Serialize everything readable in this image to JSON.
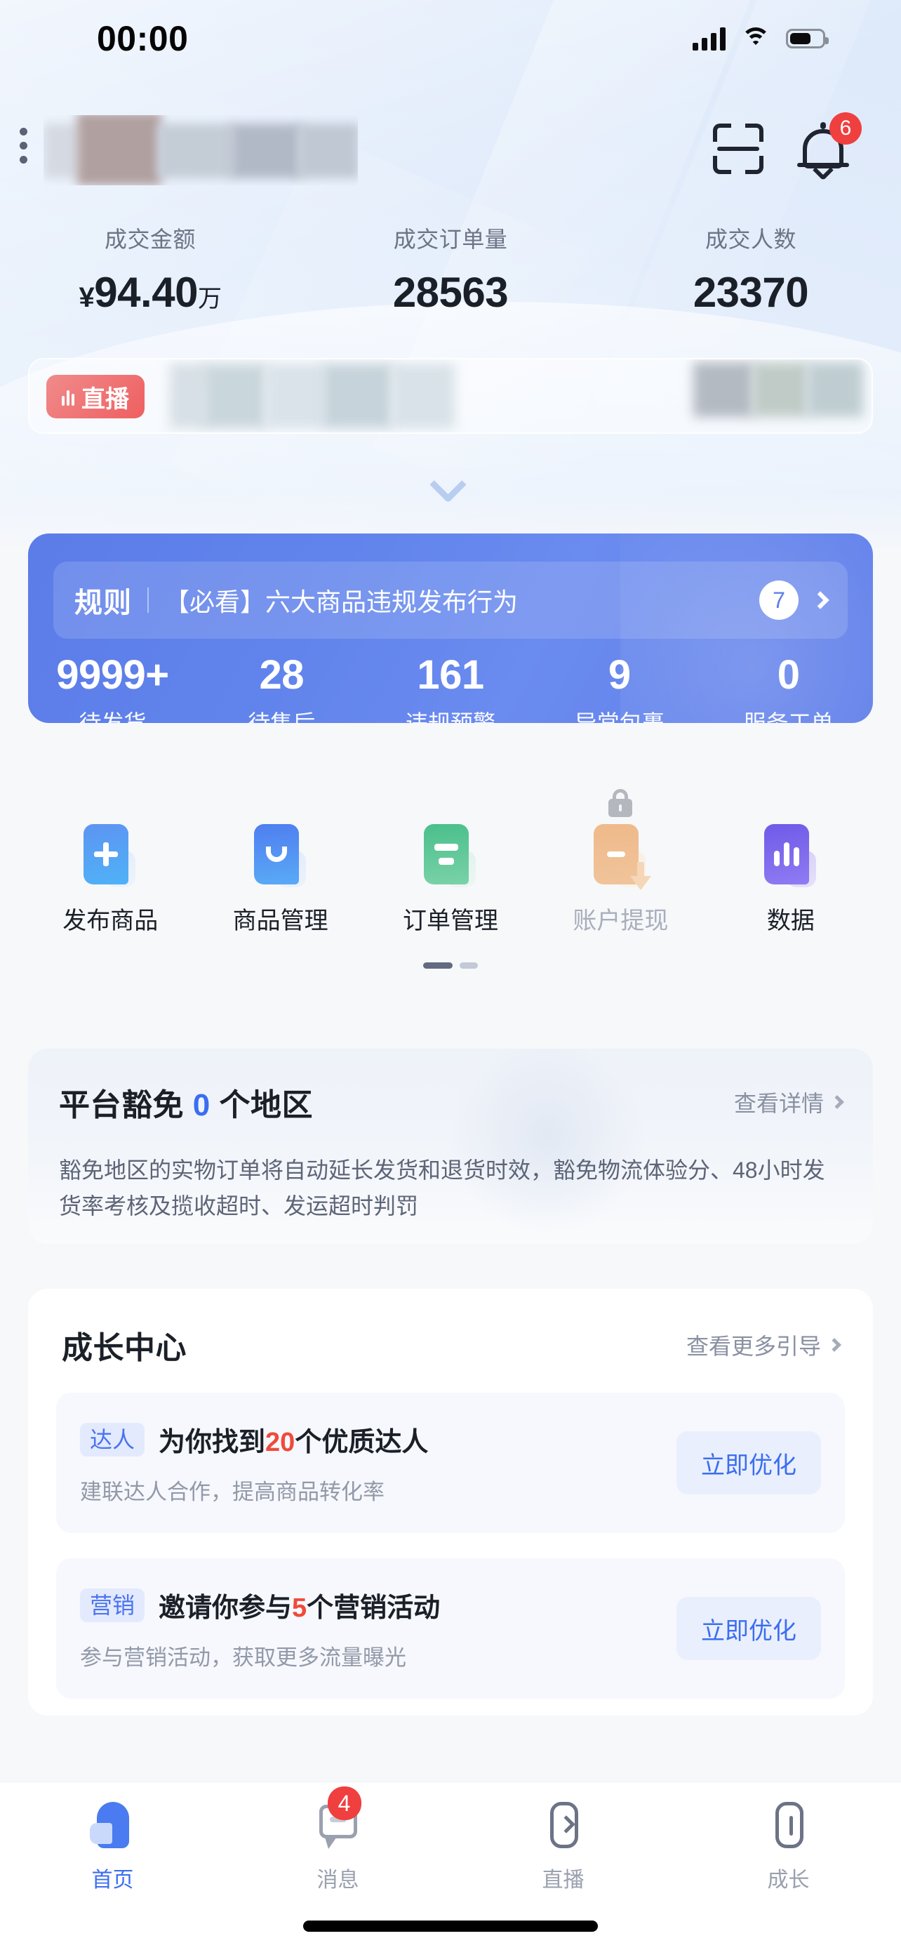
{
  "status_bar": {
    "time": "00:00",
    "signal_icon": "cellular-bars-icon",
    "wifi_icon": "wifi-icon",
    "battery_icon": "battery-icon"
  },
  "header": {
    "menu_icon": "kebab-menu-icon",
    "shop_name_redacted": "",
    "scan_icon": "scan-code-icon",
    "notification_icon": "bell-icon",
    "notification_count": "6"
  },
  "stats": [
    {
      "label": "成交金额",
      "currency": "¥",
      "value": "94.40",
      "unit": "万"
    },
    {
      "label": "成交订单量",
      "currency": "",
      "value": "28563",
      "unit": ""
    },
    {
      "label": "成交人数",
      "currency": "",
      "value": "23370",
      "unit": ""
    }
  ],
  "live_bar": {
    "badge": "直播",
    "wave_icon": "live-wave-icon",
    "content_redacted": ""
  },
  "expander": {
    "icon": "chevron-down-icon"
  },
  "rule_banner": {
    "tag": "规则",
    "text": "【必看】六大商品违规发布行为",
    "count": "7",
    "chevron_icon": "chevron-right-icon"
  },
  "todo_numbers": [
    {
      "value": "9999+",
      "label": "待发货"
    },
    {
      "value": "28",
      "label": "待售后"
    },
    {
      "value": "161",
      "label": "违规预警"
    },
    {
      "value": "9",
      "label": "异常包裹"
    },
    {
      "value": "0",
      "label": "服务工单"
    }
  ],
  "quick_actions": [
    {
      "label": "发布商品",
      "icon": "publish-product-icon",
      "disabled": false,
      "locked": false
    },
    {
      "label": "商品管理",
      "icon": "product-management-icon",
      "disabled": false,
      "locked": false
    },
    {
      "label": "订单管理",
      "icon": "order-management-icon",
      "disabled": false,
      "locked": false
    },
    {
      "label": "账户提现",
      "icon": "account-withdraw-icon",
      "disabled": true,
      "locked": true,
      "lock_icon": "lock-icon"
    },
    {
      "label": "数据",
      "icon": "data-chart-icon",
      "disabled": false,
      "locked": false
    }
  ],
  "pagination": {
    "active_index": 0,
    "total": 2
  },
  "exemption": {
    "title_prefix": "平台豁免",
    "count": "0",
    "title_suffix": "个地区",
    "link": "查看详情",
    "link_chevron_icon": "chevron-right-icon",
    "description": "豁免地区的实物订单将自动延长发货和退货时效，豁免物流体验分、48小时发货率考核及揽收超时、发运超时判罚"
  },
  "growth": {
    "title": "成长中心",
    "link": "查看更多引导",
    "link_chevron_icon": "chevron-right-icon",
    "items": [
      {
        "tag": "达人",
        "title_pre": "为你找到",
        "title_num": "20",
        "title_post": "个优质达人",
        "subtitle": "建联达人合作，提高商品转化率",
        "button": "立即优化"
      },
      {
        "tag": "营销",
        "title_pre": "邀请你参与",
        "title_num": "5",
        "title_post": "个营销活动",
        "subtitle": "参与营销活动，获取更多流量曝光",
        "button": "立即优化"
      }
    ]
  },
  "tab_bar": [
    {
      "label": "首页",
      "icon": "home-icon",
      "active": true,
      "badge": ""
    },
    {
      "label": "消息",
      "icon": "message-icon",
      "active": false,
      "badge": "4"
    },
    {
      "label": "直播",
      "icon": "live-icon",
      "active": false,
      "badge": ""
    },
    {
      "label": "成长",
      "icon": "growth-icon",
      "active": false,
      "badge": ""
    }
  ],
  "colors": {
    "accent_blue": "#3b6ef0",
    "panel_blue": "#5f7ee9",
    "badge_red": "#ef3f3f",
    "highlight_red": "#f04a3a",
    "page_bg": "#f7f8fa"
  }
}
